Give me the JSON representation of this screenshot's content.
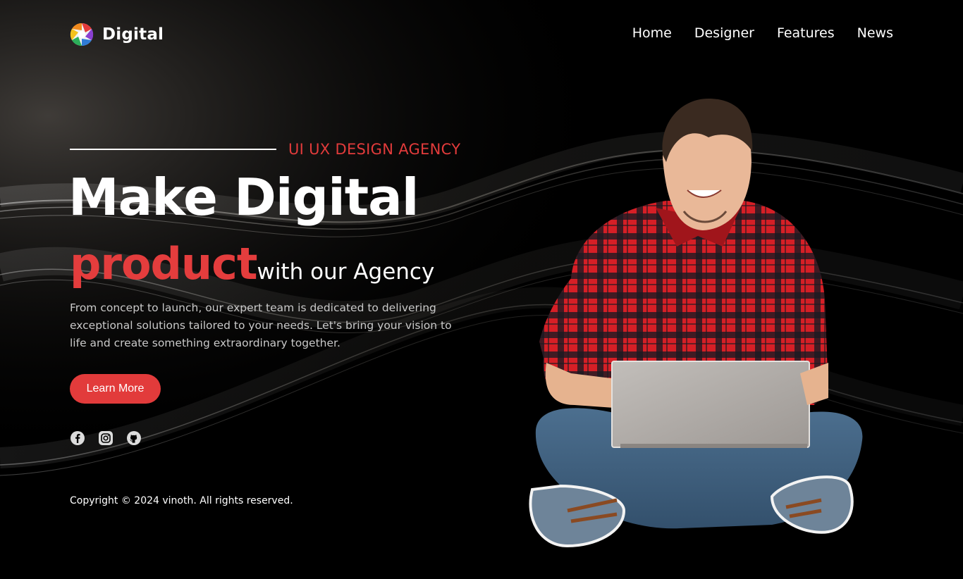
{
  "brand": {
    "name": "Digital",
    "logo_icon": "aperture-logo-icon"
  },
  "nav": [
    {
      "label": "Home"
    },
    {
      "label": "Designer"
    },
    {
      "label": "Features"
    },
    {
      "label": "News"
    }
  ],
  "hero": {
    "tagline": "UI UX DESIGN AGENCY",
    "headline": "Make Digital",
    "accent_word": "product",
    "subline_rest": "with our Agency",
    "description": "From concept to launch, our expert team is dedicated to delivering exceptional solutions tailored to your needs. Let's bring your vision to life and create something extraordinary together.",
    "cta_label": "Learn More"
  },
  "socials": [
    {
      "icon": "facebook-icon"
    },
    {
      "icon": "instagram-icon"
    },
    {
      "icon": "github-icon"
    }
  ],
  "footer": {
    "copyright": "Copyright © 2024 vinoth. All rights reserved."
  },
  "colors": {
    "accent": "#e23b3b",
    "background": "#000000",
    "text": "#ffffff",
    "muted": "#c9c9c9"
  }
}
